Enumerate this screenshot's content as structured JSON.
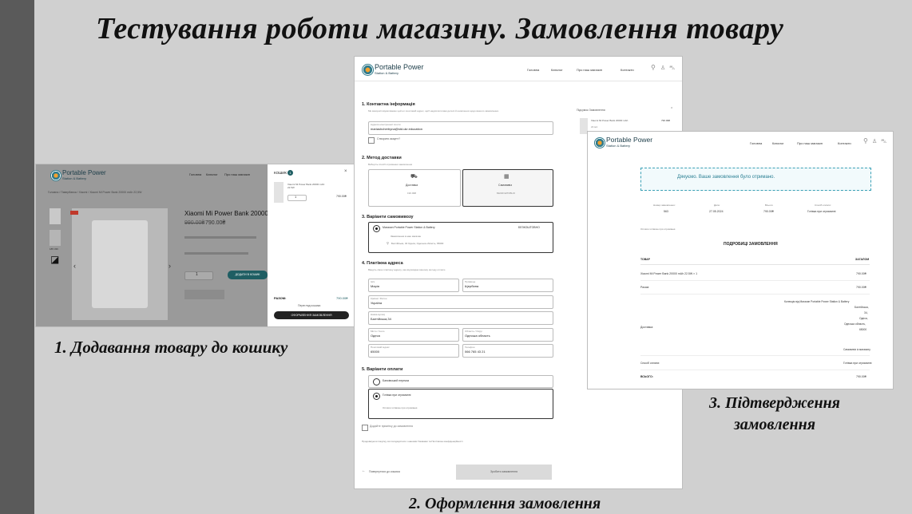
{
  "slide": {
    "title": "Тестування роботи магазину. Замовлення товару",
    "caption1": "1. Додавання товару до кошику",
    "caption2": "2. Оформлення замовлення",
    "caption3_line1": "3. Підтвердження",
    "caption3_line2": "замовлення"
  },
  "brand": {
    "name": "Portable Power",
    "tagline": "Station & Battery"
  },
  "nav": {
    "home": "Головна",
    "catalog": "Каталог",
    "about": "Про наш магазин",
    "contacts": "Контакти"
  },
  "shot1": {
    "breadcrumb": "Головна / Павербанки / Xiaomi / Xiaomi Mi Power Bank 20000 mAh 22,5W",
    "product_title": "Xiaomi Mi Power Bank 20000 m/",
    "old_price": "990.00₴",
    "price": "790.00₴",
    "qty": "1",
    "add_to_cart": "ДОДАТИ В КОШИК",
    "cart": {
      "title": "КОШИК",
      "count": "1",
      "item_name": "Xiaomi Mi Power Bank 20000 mAh 22.5W",
      "item_qty": "1",
      "item_price": "790.00₴",
      "subtotal_label": "РАЗОМ:",
      "subtotal_value": "790.00₴",
      "view_cart": "Перегляд кошика",
      "checkout": "ОФОРМЛЕННЯ ЗАМОВЛЕННЯ"
    }
  },
  "shot2": {
    "s1": "1. Контактна інформація",
    "s1_hint": "Ми використовуватимемо цей ел.поштовий адрес, щоб надсилати вам деталі й оновлення щодо вашого замовлення.",
    "email_label": "Адреса електронної пошти",
    "email": "mariashcherbyna@std.ukr.education",
    "create_account": "Створити акаунт?",
    "s2": "2. Метод доставки",
    "s2_hint": "Виберіть спосіб отримання замовлення",
    "delivery": "Доставка",
    "delivery_price": "190.00₴",
    "pickup": "Самовивіз",
    "pickup_price": "БЕЗКОШТОВНО",
    "s3": "3. Варіанти самовивозу",
    "store": "Магазин Portable Power Station & Battery",
    "store_price": "БЕЗКОШТОВНО",
    "store_note": "Замовлення в наш магазин",
    "store_addr": "Балтійська, 34 Одеса, Одеська область, 65000",
    "s4": "4. Платіжна адреса",
    "s4_hint": "Введіть свою платіжну адресу, яка відповідає вашому методу оплати.",
    "first_name_label": "Ім'я",
    "first_name": "Марія",
    "last_name_label": "Прізвище",
    "last_name": "Щербина",
    "country_label": "Країна / Регіон",
    "country": "Україна",
    "street_label": "Назва вулиці",
    "street": "Балтійська,34",
    "city_label": "Місто / Село",
    "city": "Одеса",
    "region_label": "Область / Округ",
    "region": "Одеська область",
    "zip_label": "Поштовий індекс",
    "zip": "65000",
    "phone_label": "Телефон",
    "phone": "066 765 43 21",
    "s5": "5. Варіанти оплати",
    "pay_bank": "Банківський переказ",
    "pay_cash": "Готівка при отриманні",
    "pay_cash_note": "Оплата готівкою при отриманні.",
    "add_note": "Додайте примітку до замовлення",
    "terms": "Продовжуючи покупку, ви погоджуєтеся з нашими Умовами та Політикою конфіденційності",
    "back": "Повернутися до кошика",
    "place_order": "Зробити замовлення",
    "summary_title": "Підсумок Замовлення",
    "summary_item": "Xiaomi Mi Power Bank 20000 mAh",
    "summary_price": "790.00₴",
    "summary_qty": "22 мА"
  },
  "shot3": {
    "thanks": "Дякуємо. Ваше замовлення було отримано.",
    "order_no_label": "Номер замовлення:",
    "order_no": "563",
    "date_label": "Дата:",
    "date": "27.05.2024",
    "total_label": "Всього:",
    "total": "790.00₴",
    "method_label": "Спосіб оплати:",
    "method": "Готівка при отриманні",
    "pay_note": "Оплата готівкою при отриманні.",
    "details_title": "ПОДРОБИЦІ ЗАМОВЛЕННЯ",
    "col_product": "ТОВАР",
    "col_total": "ЗАГАЛОМ",
    "row_product": "Xiaomi Mi Power Bank 20000 mAh 22.5W × 1",
    "row_product_total": "790.00₴",
    "row_subtotal": "Разом:",
    "row_subtotal_val": "790.00₴",
    "row_shipping": "Доставка:",
    "ship_l1": "Колекція від Магазин Portable Power Station & Battery",
    "ship_l2": "Балтійська,",
    "ship_l3": "34,",
    "ship_l4": "Одеса,",
    "ship_l5": "Одеська область,",
    "ship_l6": "65000",
    "ship_method": "Самовивіз із магазину",
    "row_payment": "Спосіб оплати:",
    "row_payment_val": "Готівка при отриманні",
    "row_total": "ВСЬОГО:",
    "row_total_val": "790.00₴"
  }
}
